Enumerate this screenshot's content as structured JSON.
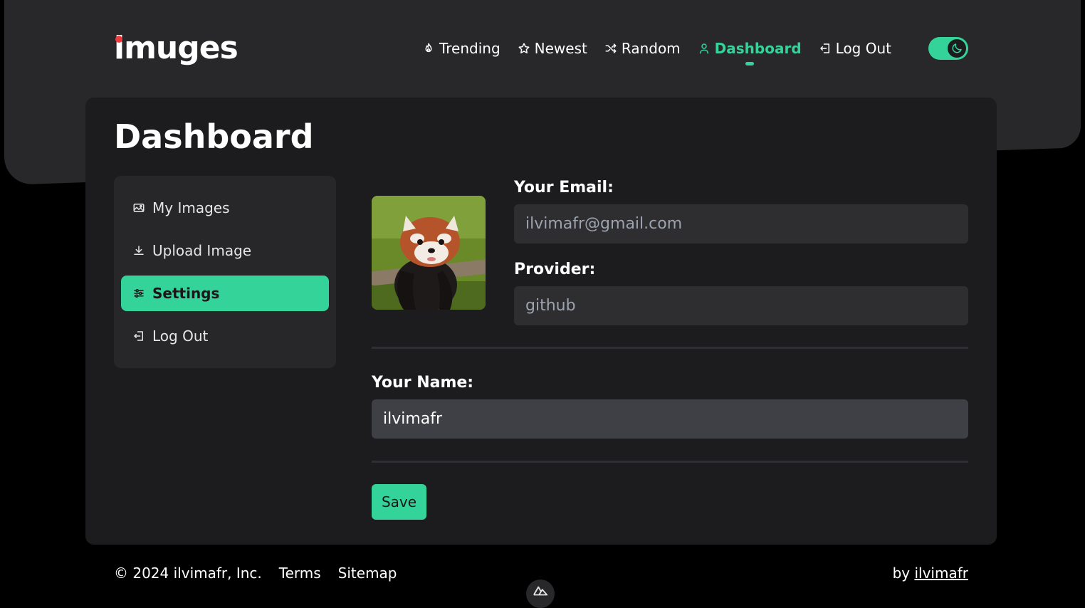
{
  "brand": {
    "name": "imuges",
    "dot_color": "#ef3b3b"
  },
  "theme": {
    "accent": "#34d399",
    "dark_mode": true
  },
  "nav": {
    "items": [
      {
        "label": "Trending",
        "icon": "flame-icon"
      },
      {
        "label": "Newest",
        "icon": "star-icon"
      },
      {
        "label": "Random",
        "icon": "shuffle-icon"
      },
      {
        "label": "Dashboard",
        "icon": "user-icon",
        "active": true
      },
      {
        "label": "Log Out",
        "icon": "logout-icon"
      }
    ],
    "theme_toggle_icon": "moon-icon"
  },
  "page": {
    "title": "Dashboard"
  },
  "sidebar": {
    "items": [
      {
        "label": "My Images",
        "icon": "image-icon"
      },
      {
        "label": "Upload Image",
        "icon": "download-icon"
      },
      {
        "label": "Settings",
        "icon": "sliders-icon",
        "active": true
      },
      {
        "label": "Log Out",
        "icon": "logout-icon"
      }
    ]
  },
  "profile": {
    "avatar_alt": "red-panda-avatar",
    "email_label": "Your Email:",
    "email_value": "ilvimafr@gmail.com",
    "provider_label": "Provider:",
    "provider_value": "github",
    "name_label": "Your Name:",
    "name_value": "ilvimafr",
    "save_label": "Save"
  },
  "footer": {
    "copyright": "© 2024 ilvimafr, Inc.",
    "links": [
      "Terms",
      "Sitemap"
    ],
    "by_label": "by",
    "author": "ilvimafr"
  }
}
